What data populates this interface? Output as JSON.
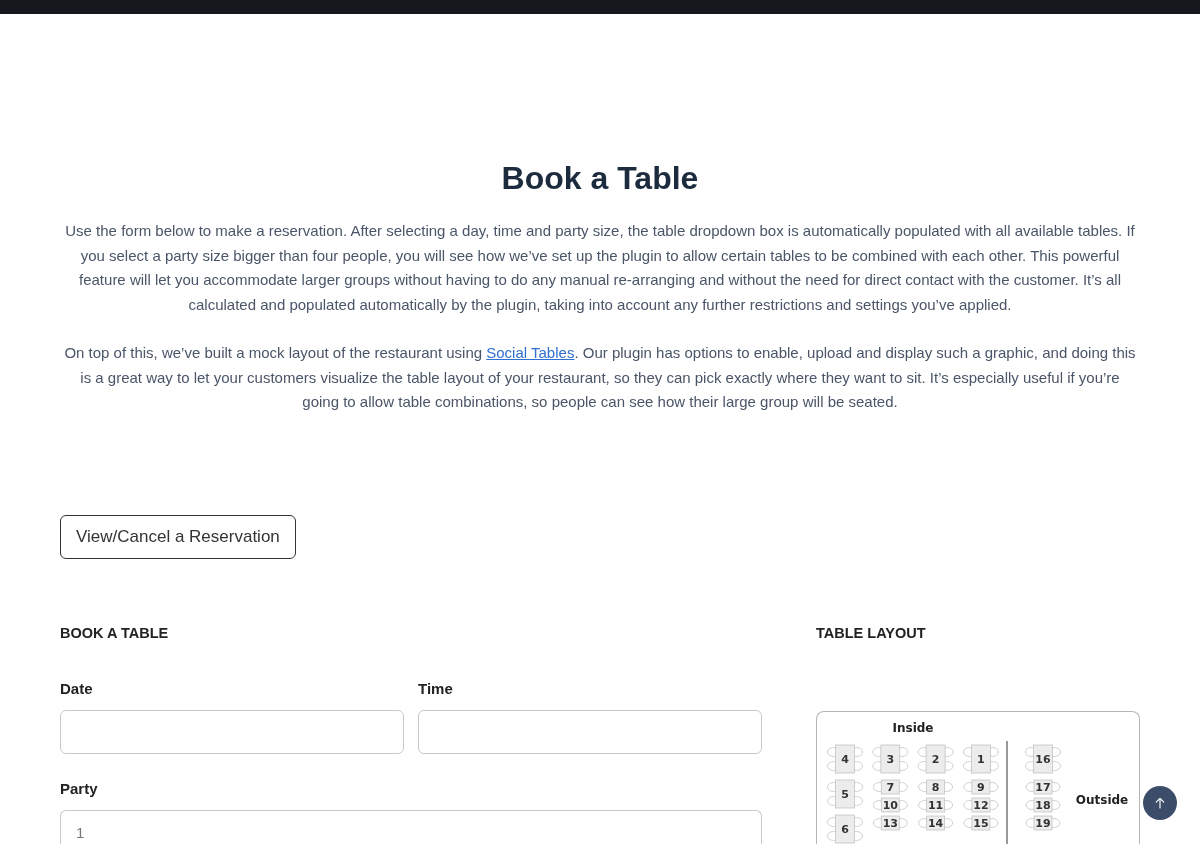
{
  "title": "Book a Table",
  "intro": [
    {
      "segments": [
        {
          "kind": "text",
          "text": "Use the form below to make a reservation. After selecting a day, time and party size, the table dropdown box is automatically populated with all available tables. If you select a party size bigger than four people, you will see how we’ve set up the plugin to allow certain tables to be combined with each other. This powerful feature will let you accommodate larger groups without having to do any manual re-arranging and without the need for direct contact with the customer. It’s all calculated and populated automatically by the plugin, taking into account any further restrictions and settings you’ve applied."
        }
      ]
    },
    {
      "segments": [
        {
          "kind": "text",
          "text": "On top of this, we’ve built a mock layout of the restaurant using "
        },
        {
          "kind": "link",
          "text": "Social Tables"
        },
        {
          "kind": "text",
          "text": ". Our plugin has options to enable, upload and display such a graphic, and doing this is a great way to let your customers visualize the table layout of your restaurant, so they can pick exactly where they want to sit. It’s especially useful if you’re going to allow table combinations, so people can see how their large group will be seated."
        }
      ]
    }
  ],
  "view_cancel_button": "View/Cancel a Reservation",
  "booking_form": {
    "heading": "BOOK A TABLE",
    "rows": [
      [
        {
          "label": "Date"
        },
        {
          "label": "Time"
        }
      ],
      [
        {
          "label": "Party",
          "placeholder": "1"
        }
      ]
    ]
  },
  "table_layout": {
    "heading": "TABLE LAYOUT",
    "areas": [
      {
        "label": "Inside",
        "columns": [
          [
            {
              "number": "4",
              "kind": "long"
            },
            {
              "number": "5",
              "kind": "long"
            },
            {
              "number": "6",
              "kind": "long"
            }
          ],
          [
            {
              "number": "3",
              "kind": "long"
            },
            {
              "number": "7",
              "kind": "short"
            },
            {
              "number": "10",
              "kind": "short"
            },
            {
              "number": "13",
              "kind": "short"
            }
          ],
          [
            {
              "number": "2",
              "kind": "long"
            },
            {
              "number": "8",
              "kind": "short"
            },
            {
              "number": "11",
              "kind": "short"
            },
            {
              "number": "14",
              "kind": "short"
            }
          ],
          [
            {
              "number": "1",
              "kind": "long"
            },
            {
              "number": "9",
              "kind": "short"
            },
            {
              "number": "12",
              "kind": "short"
            },
            {
              "number": "15",
              "kind": "short"
            }
          ]
        ]
      },
      {
        "label": "Outside",
        "columns": [
          [
            {
              "number": "16",
              "kind": "long"
            },
            {
              "number": "17",
              "kind": "short"
            },
            {
              "number": "18",
              "kind": "short"
            },
            {
              "number": "19",
              "kind": "short"
            }
          ]
        ]
      }
    ]
  }
}
